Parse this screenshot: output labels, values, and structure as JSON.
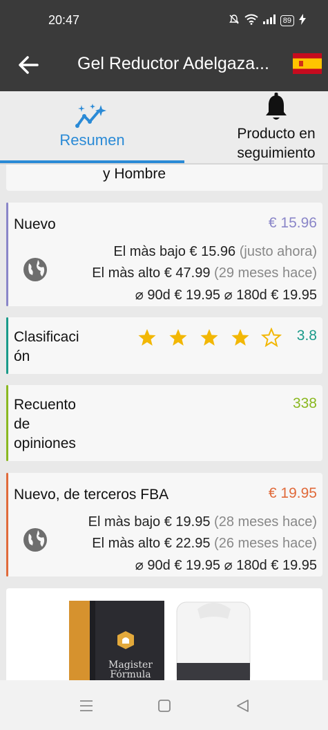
{
  "status": {
    "time": "20:47",
    "battery": "89"
  },
  "header": {
    "title": "Gel Reductor Adelgaza...",
    "flag_icon": "spain-flag-icon"
  },
  "tabs": [
    {
      "label": "Resumen",
      "icon": "trend-sparkle-icon",
      "active": true
    },
    {
      "label": "Producto en seguimiento",
      "icon": "bell-icon",
      "active": false
    }
  ],
  "partial_card": {
    "text": "y Hombre"
  },
  "nuevo": {
    "label": "Nuevo",
    "price": "€ 15.96",
    "color": "#8a86c8",
    "low_label": "El màs bajo",
    "low_value": "€ 15.96",
    "low_when": "(justo ahora)",
    "high_label": "El màs alto",
    "high_value": "€ 47.99",
    "high_when": "(29 meses hace)",
    "avg90_label": "⌀ 90d",
    "avg90_value": "€ 19.95",
    "avg180_label": "⌀ 180d",
    "avg180_value": "€ 19.95"
  },
  "rating": {
    "label": "Clasificaci ón",
    "value": "3.8",
    "stars": 4,
    "max_stars": 5,
    "color": "#1a9a8a"
  },
  "reviews": {
    "label": "Recuento de opiniones",
    "value": "338",
    "color": "#8ab820"
  },
  "fba": {
    "label": "Nuevo, de terceros FBA",
    "price": "€ 19.95",
    "color": "#e06a3a",
    "low_label": "El màs bajo",
    "low_value": "€ 19.95",
    "low_when": "(28 meses hace)",
    "high_label": "El màs alto",
    "high_value": "€ 22.95",
    "high_when": "(26 meses hace)",
    "avg90_label": "⌀ 90d",
    "avg90_value": "€ 19.95",
    "avg180_label": "⌀ 180d",
    "avg180_value": "€ 19.95"
  },
  "product_image": {
    "brand_text": "Magister Fórmula"
  }
}
